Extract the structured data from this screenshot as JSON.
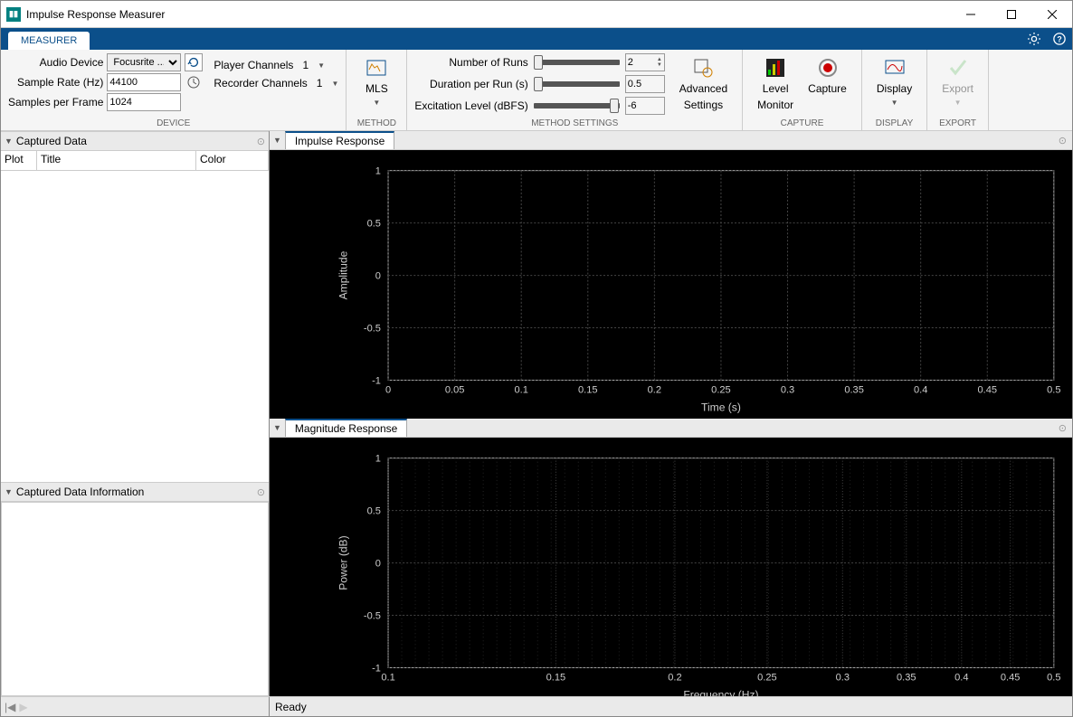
{
  "window": {
    "title": "Impulse Response Measurer"
  },
  "ribbon": {
    "tab": "MEASURER"
  },
  "device": {
    "audio_device_label": "Audio Device",
    "audio_device_value": "Focusrite ...",
    "sample_rate_label": "Sample Rate (Hz)",
    "sample_rate_value": "44100",
    "samples_per_frame_label": "Samples per Frame",
    "samples_per_frame_value": "1024",
    "player_channels_label": "Player Channels",
    "player_channels_value": "1",
    "recorder_channels_label": "Recorder Channels",
    "recorder_channels_value": "1",
    "group_label": "DEVICE"
  },
  "method": {
    "button": "MLS",
    "group_label": "METHOD"
  },
  "method_settings": {
    "num_runs_label": "Number of Runs",
    "num_runs_value": "2",
    "duration_label": "Duration per Run (s)",
    "duration_value": "0.5",
    "excitation_label": "Excitation Level (dBFS)",
    "excitation_value": "-6",
    "adv_button_l1": "Advanced",
    "adv_button_l2": "Settings",
    "group_label": "METHOD SETTINGS"
  },
  "capture": {
    "level_l1": "Level",
    "level_l2": "Monitor",
    "capture_button": "Capture",
    "group_label": "CAPTURE"
  },
  "display": {
    "button": "Display",
    "group_label": "DISPLAY"
  },
  "export": {
    "button": "Export",
    "group_label": "EXPORT"
  },
  "panels": {
    "captured_data": "Captured Data",
    "captured_data_info": "Captured Data Information",
    "impulse_response": "Impulse Response",
    "magnitude_response": "Magnitude Response"
  },
  "captured_table": {
    "plot": "Plot",
    "title": "Title",
    "color": "Color"
  },
  "status": {
    "text": "Ready"
  },
  "chart_data": [
    {
      "type": "line",
      "title": "Impulse Response",
      "xlabel": "Time (s)",
      "ylabel": "Amplitude",
      "xlim": [
        0,
        0.5
      ],
      "ylim": [
        -1,
        1
      ],
      "xticks": [
        0,
        0.05,
        0.1,
        0.15,
        0.2,
        0.25,
        0.3,
        0.35,
        0.4,
        0.45,
        0.5
      ],
      "yticks": [
        -1,
        -0.5,
        0,
        0.5,
        1
      ],
      "series": []
    },
    {
      "type": "line",
      "title": "Magnitude Response",
      "xlabel": "Frequency (Hz)",
      "ylabel": "Power (dB)",
      "xlim": [
        0.1,
        0.5
      ],
      "ylim": [
        -1,
        1
      ],
      "xticks": [
        0.1,
        0.15,
        0.2,
        0.25,
        0.3,
        0.35,
        0.4,
        0.45,
        0.5
      ],
      "yticks": [
        -1,
        -0.5,
        0,
        0.5,
        1
      ],
      "log_x": true,
      "series": []
    }
  ]
}
